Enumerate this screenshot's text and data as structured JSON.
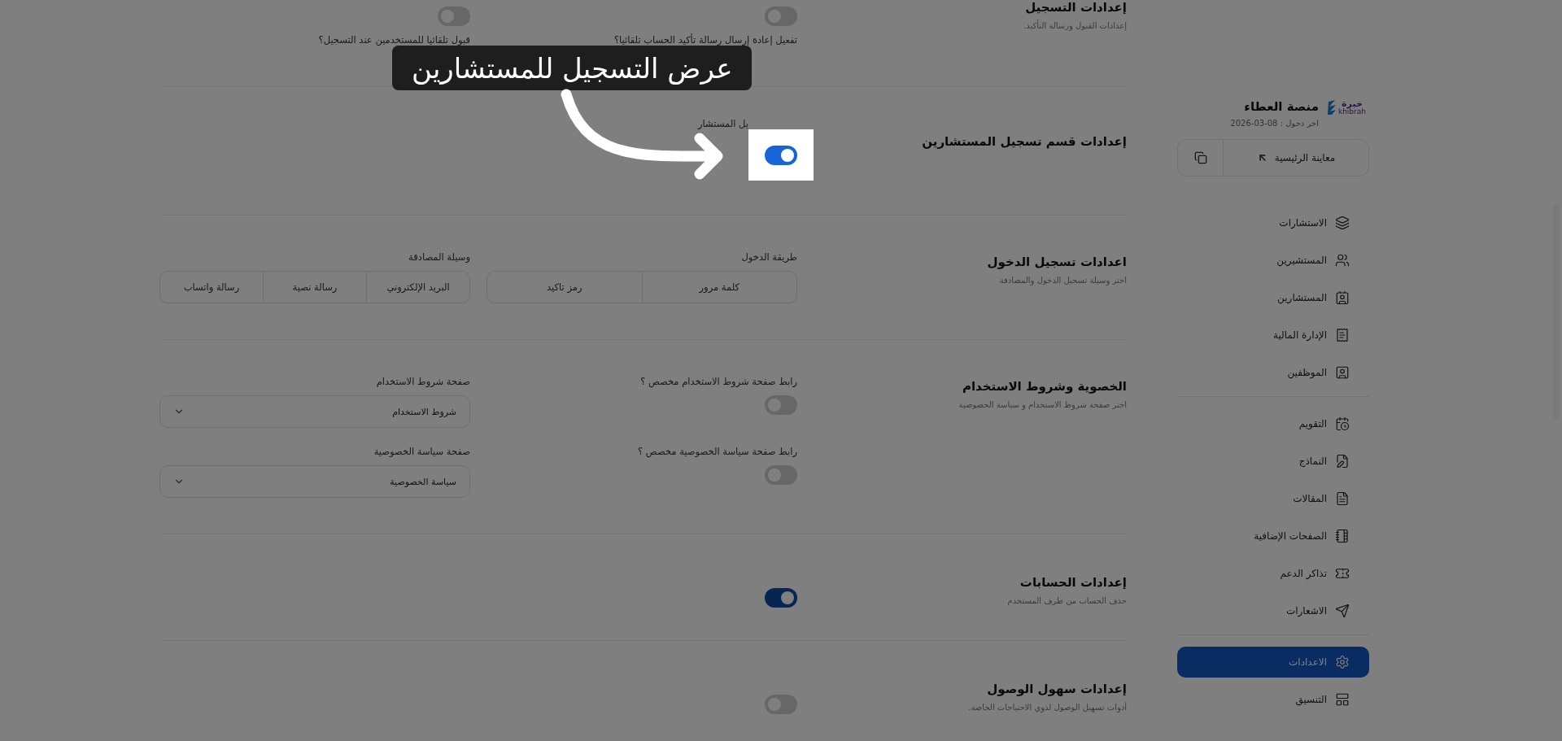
{
  "sidebar": {
    "logo": {
      "arabic": "خبرة",
      "latin": "khibrah"
    },
    "title": "منصة العطاء",
    "last_login": "اخر دخول : 08-03-2026",
    "preview_button": "معاينة الرئيسية",
    "groups": [
      {
        "items": [
          {
            "label": "الاستشارات",
            "kind": "layers",
            "selected": false
          },
          {
            "label": "المستشيرين",
            "kind": "users",
            "selected": false
          },
          {
            "label": "المستشارين",
            "kind": "contact",
            "selected": false
          },
          {
            "label": "الإدارة المالية",
            "kind": "receipt",
            "selected": false
          },
          {
            "label": "الموظفين",
            "kind": "user-square",
            "selected": false
          }
        ]
      },
      {
        "items": [
          {
            "label": "التقويم",
            "kind": "calendar",
            "selected": false
          },
          {
            "label": "النماذج",
            "kind": "form",
            "selected": false
          },
          {
            "label": "المقالات",
            "kind": "article",
            "selected": false
          },
          {
            "label": "الصفحات الإضافية",
            "kind": "notebook",
            "selected": false
          },
          {
            "label": "تذاكر الدعم",
            "kind": "ticket",
            "selected": false
          },
          {
            "label": "الاشعارات",
            "kind": "send",
            "selected": false
          }
        ]
      },
      {
        "items": [
          {
            "label": "الاعدادات",
            "kind": "settings",
            "selected": true
          },
          {
            "label": "التنسيق",
            "kind": "layout",
            "selected": false
          }
        ]
      }
    ]
  },
  "sections": [
    {
      "kind": "toggles_above",
      "title": "إعدادات التسجيل",
      "subtitle": "إعدادات القبول ورسالة التأكيد.",
      "fields": [
        {
          "kind": "toggle",
          "label": "تفعيل إعادة إرسال رسالة تأكيد الحساب تلقائيا؟",
          "on": false
        },
        {
          "kind": "toggle",
          "label": "قبول تلقائيا للمستخدمين عند التسجيل؟",
          "on": false
        }
      ]
    },
    {
      "kind": "spotlight",
      "title": "إعدادات قسم تسجيل المستشارين",
      "fields": [
        {
          "kind": "toggle",
          "label": "يل المستشار",
          "on": true,
          "highlighted": true
        }
      ]
    },
    {
      "kind": "fields",
      "title": "اعدادات تسجيل الدخول",
      "subtitle": "اختر وسيلة تسجيل الدخول والمصادقة",
      "fields": [
        {
          "kind": "segmented",
          "label": "طريقة الدخول",
          "options": [
            "كلمة مرور",
            "رمز تاكيد"
          ]
        },
        {
          "kind": "segmented",
          "label": "وسيلة المصادقة",
          "options": [
            "البريد الإلكتروني",
            "رسالة نصية",
            "رسالة واتساب"
          ]
        }
      ]
    },
    {
      "kind": "fields",
      "title": "الخصوية وشروط الاستخدام",
      "subtitle": "اختر صفحة شروط الاستخدام و سياسة الخصوصية",
      "fields": [
        {
          "kind": "toggle",
          "label": "رابط صفحة شروط الاستخدام مخصص ؟",
          "on": false
        },
        {
          "kind": "select",
          "label": "صفحة شروط الاستخدام",
          "value": "شروط الاستخدام"
        },
        {
          "kind": "toggle",
          "label": "رابط صفحة سياسة الخصوصية مخصص ؟",
          "on": false
        },
        {
          "kind": "select",
          "label": "صفحة سياسة الخصوصية",
          "value": "سياسة الخصوصية"
        }
      ]
    },
    {
      "kind": "fields",
      "title": "إعدادات الحسابات",
      "subtitle": "حذف الحساب من طرف المستخدم",
      "fields": [
        {
          "kind": "toggle",
          "on": true
        }
      ]
    },
    {
      "kind": "fields",
      "title": "إعدادات سهول الوصول",
      "subtitle": "أدوات تسهيل الوصول لذوي الاحتياجات الخاصة.",
      "fields": [
        {
          "kind": "toggle",
          "on": false
        }
      ]
    }
  ],
  "tour": {
    "dimmed": true,
    "tooltip": "عرض التسجيل للمستشارين"
  }
}
